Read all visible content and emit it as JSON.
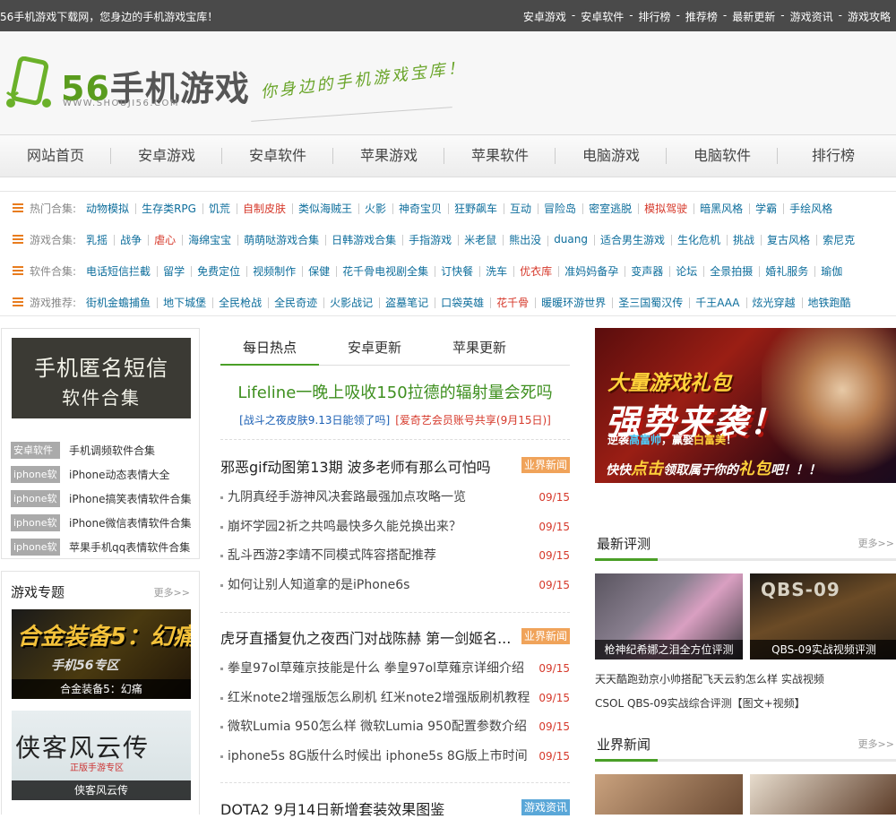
{
  "topbar": {
    "slogan": "56手机游戏下载网，您身边的手机游戏宝库！",
    "links": [
      "安卓游戏",
      "安卓软件",
      "排行榜",
      "推荐榜",
      "最新更新",
      "游戏资讯",
      "游戏攻略"
    ],
    "separator": "-"
  },
  "header": {
    "logo_num": "56",
    "logo_zh": "手机游戏",
    "logo_url": "WWW.SHOUJI56.COM",
    "tagline": "你身边的手机游戏宝库！"
  },
  "nav": [
    "网站首页",
    "安卓游戏",
    "安卓软件",
    "苹果游戏",
    "苹果软件",
    "电脑游戏",
    "电脑软件",
    "排行榜"
  ],
  "tags": {
    "hot": {
      "label": "热门合集:",
      "items": [
        "动物模拟",
        "生存类RPG",
        "饥荒",
        "自制皮肤",
        "类似海贼王",
        "火影",
        "神奇宝贝",
        "狂野飙车",
        "互动",
        "冒险岛",
        "密室逃脱",
        "模拟驾驶",
        "暗黑风格",
        "学霸",
        "手绘风格"
      ],
      "red": [
        3,
        11
      ]
    },
    "game": {
      "label": "游戏合集:",
      "items": [
        "乳摇",
        "战争",
        "虐心",
        "海绵宝宝",
        "萌萌哒游戏合集",
        "日韩游戏合集",
        "手指游戏",
        "米老鼠",
        "熊出没",
        "duang",
        "适合男生游戏",
        "生化危机",
        "挑战",
        "复古风格",
        "索尼克"
      ],
      "red": [
        2
      ]
    },
    "soft": {
      "label": "软件合集:",
      "items": [
        "电话短信拦截",
        "留学",
        "免费定位",
        "视频制作",
        "保健",
        "花千骨电视剧全集",
        "订快餐",
        "洗车",
        "优衣库",
        "准妈妈备孕",
        "变声器",
        "论坛",
        "全景拍摄",
        "婚礼服务",
        "瑜伽"
      ],
      "red": [
        8
      ]
    },
    "recommend": {
      "label": "游戏推荐:",
      "items": [
        "街机金蟾捕鱼",
        "地下城堡",
        "全民枪战",
        "全民奇迹",
        "火影战记",
        "盗墓笔记",
        "口袋英雄",
        "花千骨",
        "暖暖环游世界",
        "圣三国蜀汉传",
        "千王AAA",
        "炫光穿越",
        "地铁跑酷"
      ],
      "red": [
        7
      ]
    }
  },
  "left": {
    "chalk_line1": "手机匿名短信",
    "chalk_line2": "软件合集",
    "soft_list": [
      {
        "badge": "安卓软件",
        "text": "手机调频软件合集"
      },
      {
        "badge": "iphone软",
        "text": "iPhone动态表情大全"
      },
      {
        "badge": "iphone软",
        "text": "iPhone搞笑表情软件合集"
      },
      {
        "badge": "iphone软",
        "text": "iPhone微信表情软件合集"
      },
      {
        "badge": "iphone软",
        "text": "苹果手机qq表情软件合集"
      }
    ],
    "topic_title": "游戏专题",
    "more": "更多>>",
    "topic1_big": "合金装备5：幻痛",
    "topic1_sub": "手机56专区",
    "topic1_cap": "合金装备5：幻痛",
    "topic2_big": "侠客风云传",
    "topic2_seal": "正版手游专区",
    "topic2_cap": "侠客风云传"
  },
  "middle": {
    "tabs": [
      "每日热点",
      "安卓更新",
      "苹果更新"
    ],
    "headline": "Lifeline一晚上吸收150拉德的辐射量会死吗",
    "sub1": "[战斗之夜皮肤9.13日能领了吗]",
    "sub2": "[爱奇艺会员账号共享(9月15日)]",
    "blocks": [
      {
        "title": "邪恶gif动图第13期 波多老师有那么可怕吗",
        "cat": "业界新闻",
        "items": [
          {
            "t": "九阴真经手游神风决套路最强加点攻略一览",
            "d": "09/15"
          },
          {
            "t": "崩坏学园2祈之共鸣最快多久能兑换出来？",
            "d": "09/15"
          },
          {
            "t": "乱斗西游2李靖不同模式阵容搭配推荐",
            "d": "09/15"
          },
          {
            "t": "如何让别人知道拿的是iPhone6s",
            "d": "09/15"
          }
        ]
      },
      {
        "title": "虎牙直播复仇之夜西门对战陈赫 第一剑姬名...",
        "cat": "业界新闻",
        "items": [
          {
            "t": "拳皇97ol草薙京技能是什么 拳皇97ol草薙京详细介绍",
            "d": "09/15"
          },
          {
            "t": "红米note2增强版怎么刷机 红米note2增强版刷机教程",
            "d": "09/15"
          },
          {
            "t": "微软Lumia 950怎么样 微软Lumia 950配置参数介绍",
            "d": "09/15"
          },
          {
            "t": "iphone5s 8G版什么时候出 iphone5s 8G版上市时间",
            "d": "09/15"
          }
        ]
      },
      {
        "title": "DOTA2 9月14日新增套装效果图鉴",
        "cat": "游戏资讯",
        "items": []
      }
    ]
  },
  "right": {
    "banner_l1": "大量游戏礼包",
    "banner_l2": "强势来袭！",
    "banner_l3a": "逆袭",
    "banner_l3b": "高富帅",
    "banner_l3c": "，赢娶",
    "banner_l3d": "白富美",
    "banner_l3e": "！",
    "banner_l4a": "快快",
    "banner_l4b": "点击",
    "banner_l4c": "领取属于你的",
    "banner_l4d": "礼包",
    "banner_l4e": "吧！！！",
    "review_title": "最新评测",
    "more": "更多>>",
    "pic1_cap": "枪神纪希娜之泪全方位评测",
    "pic2_label": "QBS-09",
    "pic2_cap": "QBS-09实战视频评测",
    "text1": "天天酷跑劲京小帅搭配飞天云豹怎么样 实战视频",
    "text2": "CSOL QBS-09实战综合评测【图文+视频】",
    "news_title": "业界新闻"
  }
}
